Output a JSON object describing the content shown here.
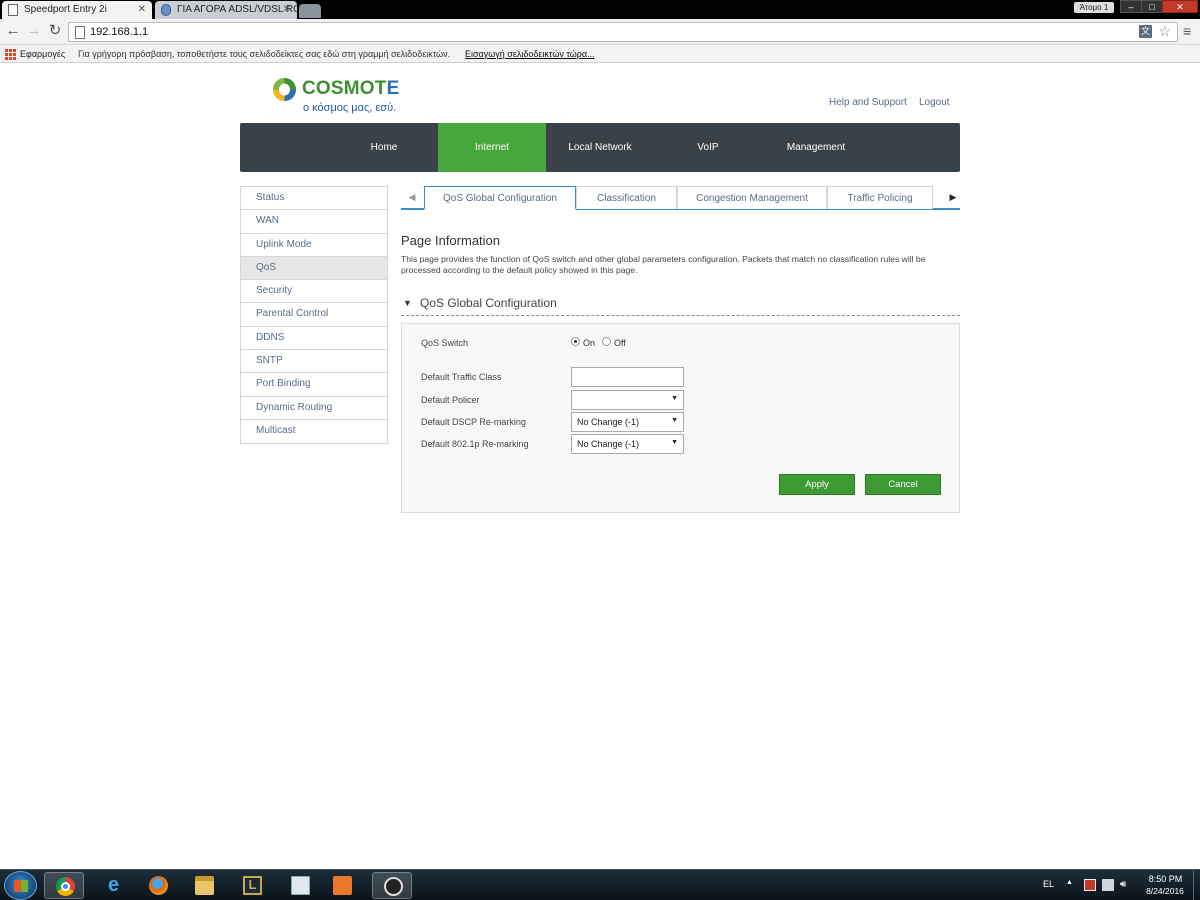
{
  "browser": {
    "tabs": [
      {
        "title": "Speedport Entry 2i",
        "active": true
      },
      {
        "title": "ΓΙΑ ΑΓΟΡΑ ADSL/VDSL RO",
        "active": false
      }
    ],
    "profile": "Άτομο 1",
    "window_controls": {
      "minimize": "–",
      "maximize": "□",
      "close": "✕"
    },
    "url": "192.168.1.1",
    "bookmarks": {
      "apps_label": "Εφαρμογές",
      "hint": "Για γρήγορη πρόσβαση, τοποθετήστε τους σελιδοδείκτες σας εδώ στη γραμμή σελιδοδεικτών.",
      "import_link": "Εισαγωγή σελιδοδεικτών τώρα..."
    }
  },
  "header": {
    "logo_word_part1": "COSMOT",
    "logo_word_part2": "E",
    "logo_tagline": "ο κόσμος μας, εσύ.",
    "help_link": "Help and Support",
    "logout_link": "Logout",
    "brand_green": "#48a73c",
    "brand_dark": "#3a4247"
  },
  "main_nav": {
    "items": [
      {
        "label": "Home"
      },
      {
        "label": "Internet",
        "active": true
      },
      {
        "label": "Local Network"
      },
      {
        "label": "VoIP"
      },
      {
        "label": "Management"
      }
    ]
  },
  "side_menu": {
    "items": [
      {
        "label": "Status"
      },
      {
        "label": "WAN"
      },
      {
        "label": "Uplink Mode"
      },
      {
        "label": "QoS",
        "active": true
      },
      {
        "label": "Security"
      },
      {
        "label": "Parental Control"
      },
      {
        "label": "DDNS"
      },
      {
        "label": "SNTP"
      },
      {
        "label": "Port Binding"
      },
      {
        "label": "Dynamic Routing"
      },
      {
        "label": "Multicast"
      }
    ]
  },
  "sub_tabs": {
    "prev_icon": "◀",
    "next_icon": "▶",
    "items": [
      {
        "label": "QoS Global Configuration",
        "active": true
      },
      {
        "label": "Classification"
      },
      {
        "label": "Congestion Management"
      },
      {
        "label": "Traffic Policing"
      }
    ]
  },
  "page_info": {
    "title": "Page Information",
    "description": "This page provides the function of QoS switch and other global parameters configuration. Packets that match no classification rules will be processed according to the default policy showed in this page."
  },
  "section": {
    "toggle_icon": "▼",
    "title": "QoS Global Configuration"
  },
  "form": {
    "qos_switch": {
      "label": "QoS Switch",
      "options": [
        "On",
        "Off"
      ],
      "selected": "On"
    },
    "default_traffic_class": {
      "label": "Default Traffic Class",
      "value": ""
    },
    "default_policer": {
      "label": "Default Policer",
      "selected": ""
    },
    "default_dscp": {
      "label": "Default DSCP Re-marking",
      "selected": "No Change (-1)"
    },
    "default_8021p": {
      "label": "Default 802.1p Re-marking",
      "selected": "No Change (-1)"
    },
    "apply_label": "Apply",
    "cancel_label": "Cancel"
  },
  "taskbar": {
    "apps": [
      "windows-explorer",
      "chrome",
      "internet-explorer",
      "firefox",
      "file-manager",
      "league-of-legends",
      "notepad",
      "media-player",
      "obs"
    ],
    "language": "EL",
    "time": "8:50 PM",
    "date": "8/24/2016"
  }
}
